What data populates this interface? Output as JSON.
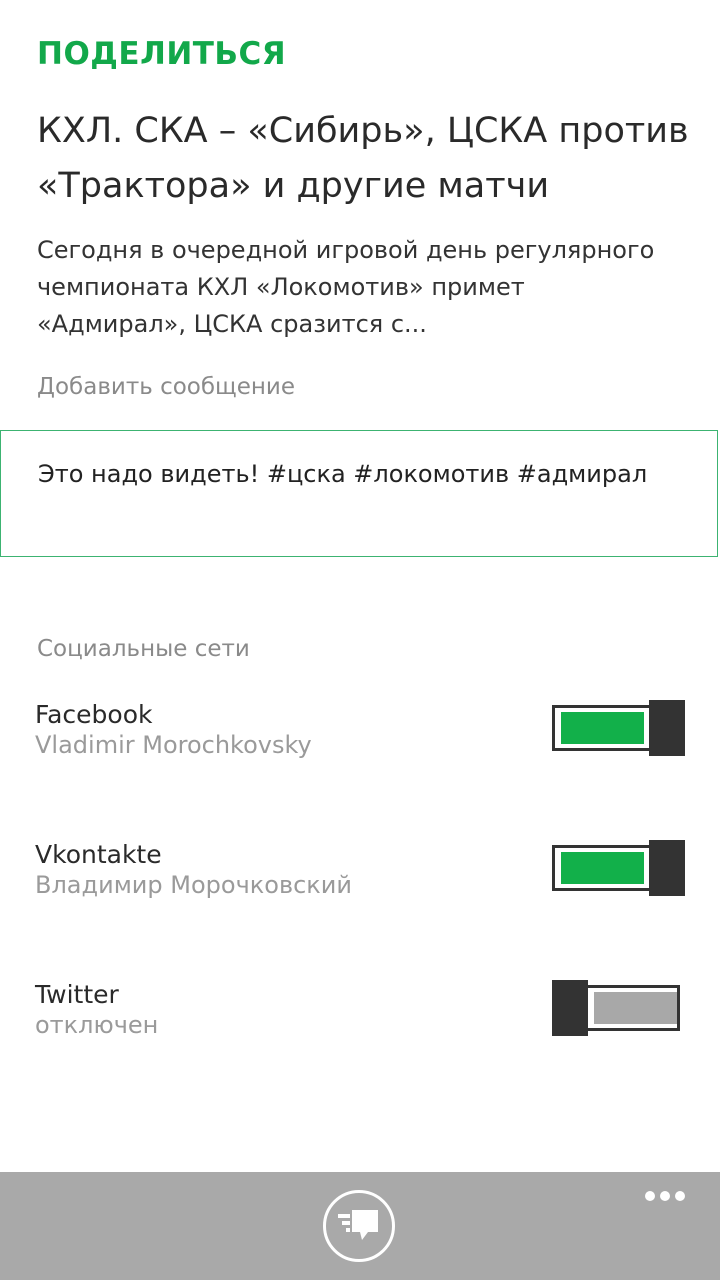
{
  "header": {
    "title": "ПОДЕЛИТЬСЯ"
  },
  "article": {
    "title": "КХЛ. СКА – «Сибирь», ЦСКА против «Трактора» и другие матчи",
    "summary": "Сегодня в очередной игровой день регулярного чемпионата КХЛ «Локомотив» примет «Адмирал», ЦСКА сразится с..."
  },
  "message": {
    "label": "Добавить сообщение",
    "value": "Это надо видеть! #цска #локомотив #адмирал"
  },
  "social": {
    "header": "Социальные сети",
    "networks": [
      {
        "name": "Facebook",
        "account": "Vladimir Morochkovsky",
        "enabled": true
      },
      {
        "name": "Vkontakte",
        "account": "Владимир Морочковский",
        "enabled": true
      },
      {
        "name": "Twitter",
        "account": "отключен",
        "enabled": false
      }
    ]
  },
  "app_bar": {
    "share_icon": "share-icon",
    "more_icon": "more-icon"
  },
  "colors": {
    "accent": "#12a84a",
    "toggle_on": "#12b04a",
    "toggle_off": "#a8a8a8",
    "app_bar": "#a9a9a9"
  }
}
